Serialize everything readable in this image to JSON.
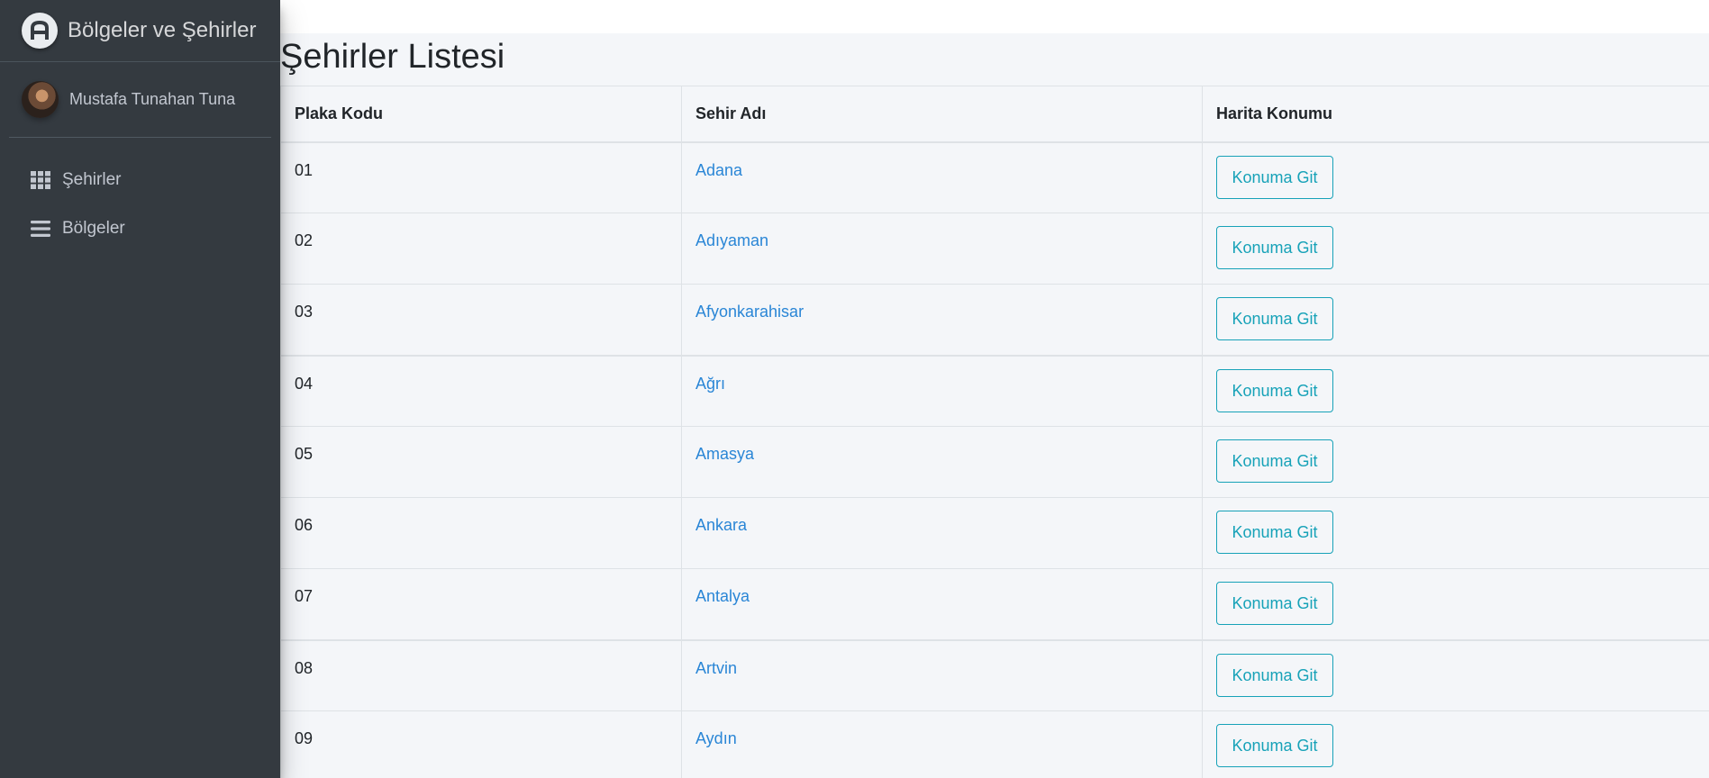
{
  "brand": {
    "title": "Bölgeler ve Şehirler",
    "logo_icon": "admin-logo-icon"
  },
  "user": {
    "name": "Mustafa Tunahan Tuna"
  },
  "nav": {
    "items": [
      {
        "label": "Şehirler",
        "icon": "grid-icon"
      },
      {
        "label": "Bölgeler",
        "icon": "bars-icon"
      }
    ]
  },
  "page": {
    "title": "Şehirler Listesi"
  },
  "table": {
    "headers": [
      "Plaka Kodu",
      "Sehir Adı",
      "Harita Konumu"
    ],
    "button_label": "Konuma Git",
    "rows": [
      {
        "code": "01",
        "city": "Adana"
      },
      {
        "code": "02",
        "city": "Adıyaman"
      },
      {
        "code": "03",
        "city": "Afyonkarahisar"
      },
      {
        "code": "04",
        "city": "Ağrı"
      },
      {
        "code": "05",
        "city": "Amasya"
      },
      {
        "code": "06",
        "city": "Ankara"
      },
      {
        "code": "07",
        "city": "Antalya"
      },
      {
        "code": "08",
        "city": "Artvin"
      },
      {
        "code": "09",
        "city": "Aydın"
      }
    ]
  },
  "colors": {
    "sidebar_bg": "#343a40",
    "content_bg": "#f4f6f9",
    "link": "#2a86d6",
    "button_outline": "#17a2b8"
  }
}
